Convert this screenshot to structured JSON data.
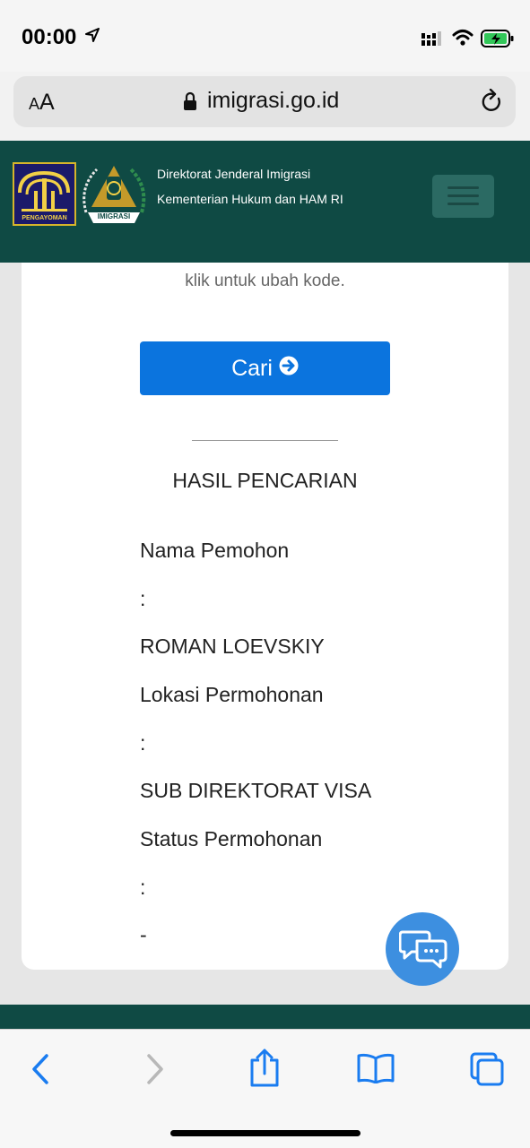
{
  "status_bar": {
    "time": "00:00",
    "icons": [
      "location-arrow-icon",
      "cellular-signal-icon",
      "wifi-icon",
      "battery-charging-icon"
    ]
  },
  "browser": {
    "text_size_label_small": "A",
    "text_size_label_large": "A",
    "url": "imigrasi.go.id",
    "toolbar_icons": [
      "back-icon",
      "forward-icon",
      "share-icon",
      "bookmarks-icon",
      "tabs-icon"
    ]
  },
  "header": {
    "logo1_caption": "PENGAYOMAN",
    "logo2_caption": "IMIGRASI",
    "org_line1": "Direktorat Jenderal Imigrasi",
    "org_line2": "Kementerian Hukum dan HAM RI"
  },
  "search": {
    "captcha_hint": "klik untuk ubah kode.",
    "submit_label": "Cari"
  },
  "results": {
    "title": "HASIL PENCARIAN",
    "fields": [
      {
        "label": "Nama Pemohon",
        "separator": ":",
        "value": "ROMAN LOEVSKIY"
      },
      {
        "label": "Lokasi Permohonan",
        "separator": ":",
        "value": "SUB DIREKTORAT VISA"
      },
      {
        "label": "Status Permohonan",
        "separator": ":",
        "value": "-"
      }
    ]
  },
  "colors": {
    "header_bg": "#0f4a44",
    "primary_button": "#0b74de",
    "chat_button": "#3d8fe0",
    "ios_tint": "#1a7cf0"
  }
}
